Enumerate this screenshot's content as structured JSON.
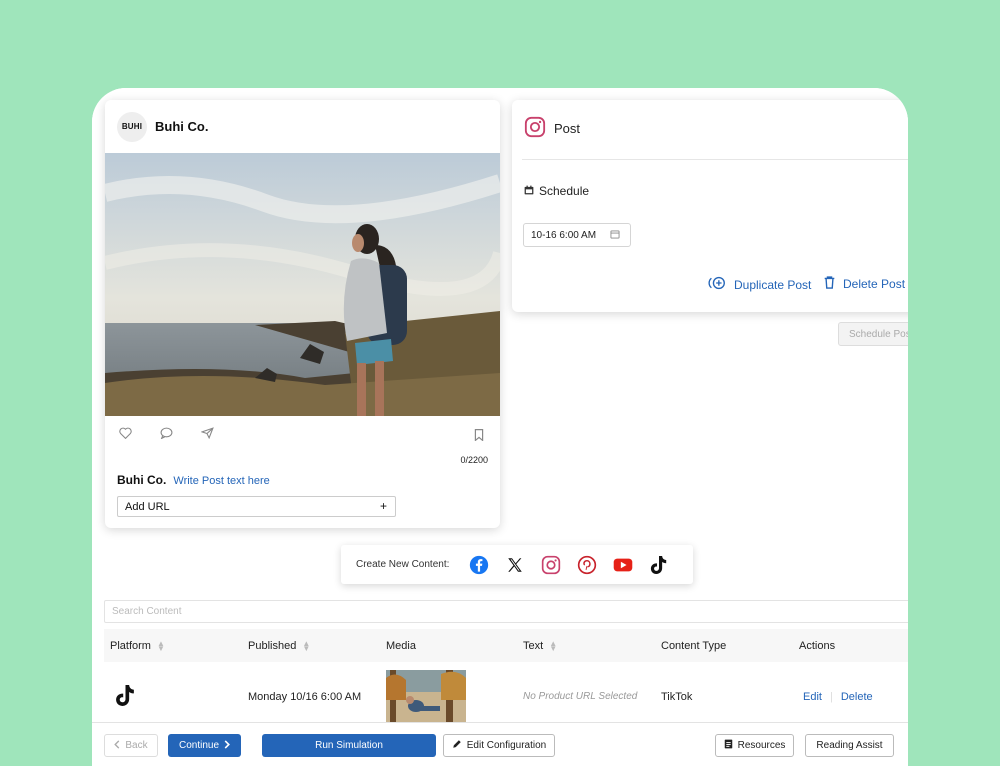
{
  "post_preview": {
    "avatar_text": "BUHI",
    "account_name": "Buhi Co.",
    "char_counter": "0/2200",
    "caption_author": "Buhi Co.",
    "caption_placeholder": "Write Post text here",
    "add_url_label": "Add URL",
    "add_url_symbol": "+"
  },
  "schedule_panel": {
    "platform_title": "Post",
    "schedule_label": "Schedule",
    "date_value": "10-16 6:00 AM",
    "duplicate_label": "Duplicate Post",
    "delete_label": "Delete Post",
    "schedule_post_label": "Schedule Post"
  },
  "create_bar": {
    "label": "Create New Content:",
    "platforms": [
      "facebook-icon",
      "x-icon",
      "instagram-icon",
      "pinterest-icon",
      "youtube-icon",
      "tiktok-icon"
    ]
  },
  "search": {
    "placeholder": "Search Content"
  },
  "table": {
    "headers": [
      "Platform",
      "Published",
      "Media",
      "Text",
      "Content Type",
      "Actions"
    ],
    "rows": [
      {
        "platform_icon": "tiktok-icon",
        "published": "Monday 10/16 6:00 AM",
        "text": "No Product URL Selected",
        "content_type": "TikTok",
        "edit": "Edit",
        "delete": "Delete"
      }
    ]
  },
  "footer": {
    "back": "Back",
    "continue": "Continue",
    "run_simulation": "Run Simulation",
    "edit_configuration": "Edit Configuration",
    "resources": "Resources",
    "reading_assist": "Reading Assist"
  },
  "colors": {
    "background": "#9fe5bb",
    "accent": "#2465b8",
    "instagram": "#c8416c",
    "facebook": "#1877f2",
    "pinterest": "#c8232c",
    "youtube": "#e62117"
  }
}
